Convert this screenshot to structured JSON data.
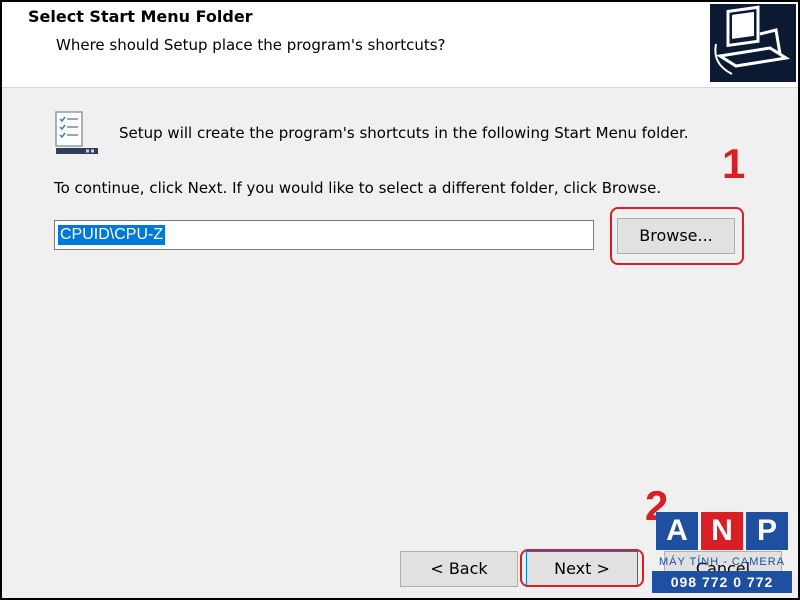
{
  "header": {
    "title": "Select Start Menu Folder",
    "subtitle": "Where should Setup place the program's shortcuts?"
  },
  "main": {
    "intro": "Setup will create the program's shortcuts in the following Start Menu folder.",
    "instruction": "To continue, click Next. If you would like to select a different folder, click Browse.",
    "folder_value": "CPUID\\CPU-Z",
    "browse_label": "Browse..."
  },
  "footer": {
    "back_label": "< Back",
    "next_label": "Next >",
    "cancel_label": "Cancel"
  },
  "annotations": {
    "step1": "1",
    "step2": "2",
    "highlight_color": "#d81f26"
  },
  "watermark": {
    "letters": [
      "A",
      "N",
      "P"
    ],
    "line1": "MÁY TÍNH - CAMERA",
    "line2": "098 772 0 772",
    "colors": [
      "#1e4fa0",
      "#d81f26",
      "#1e4fa0"
    ]
  }
}
